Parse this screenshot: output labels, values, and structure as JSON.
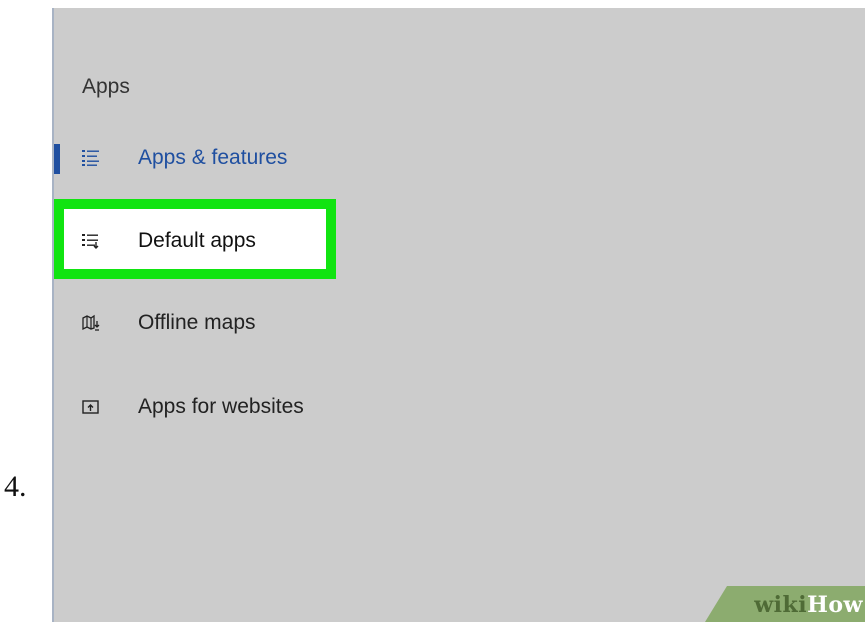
{
  "step": {
    "number": "4."
  },
  "sidebar": {
    "section_title": "Apps",
    "items": [
      {
        "label": "Apps & features",
        "icon": "list-icon",
        "selected": true
      },
      {
        "label": "Default apps",
        "icon": "list-arrow-icon",
        "highlighted": true
      },
      {
        "label": "Offline maps",
        "icon": "map-download-icon"
      },
      {
        "label": "Apps for websites",
        "icon": "window-upload-icon"
      }
    ]
  },
  "watermark": {
    "part1": "wiki",
    "part2": "How"
  },
  "colors": {
    "accent": "#1f4fa0",
    "highlight": "#11e411",
    "panel_bg": "#cccccc",
    "watermark_bg": "#8cac6f"
  }
}
